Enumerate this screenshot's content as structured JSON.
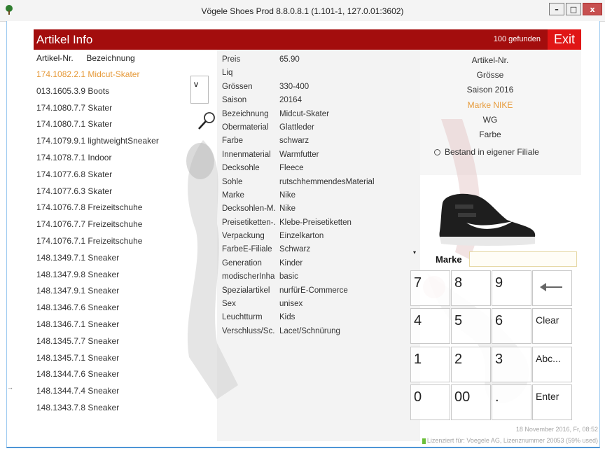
{
  "window": {
    "title": "Vögele Shoes Prod 8.8.0.8.1 (1.101-1, 127.0.01:3602)",
    "min_label": "–",
    "max_label": "□",
    "close_label": "x"
  },
  "header": {
    "title": "Artikel Info",
    "found": "100 gefunden",
    "exit_label": "Exit"
  },
  "list": {
    "col_nr": "Artikel-Nr.",
    "col_bez": "Bezeichnung",
    "rows": [
      {
        "nr": "174.1082.2.1",
        "bez": "Midcut-Skater"
      },
      {
        "nr": "013.1605.3.9",
        "bez": "Boots"
      },
      {
        "nr": "174.1080.7.7",
        "bez": "Skater"
      },
      {
        "nr": "174.1080.7.1",
        "bez": "Skater"
      },
      {
        "nr": "174.1079.9.1",
        "bez": "lightweightSneaker"
      },
      {
        "nr": "174.1078.7.1",
        "bez": "Indoor"
      },
      {
        "nr": "174.1077.6.8",
        "bez": "Skater"
      },
      {
        "nr": "174.1077.6.3",
        "bez": "Skater"
      },
      {
        "nr": "174.1076.7.8",
        "bez": "Freizeitschuhe"
      },
      {
        "nr": "174.1076.7.7",
        "bez": "Freizeitschuhe"
      },
      {
        "nr": "174.1076.7.1",
        "bez": "Freizeitschuhe"
      },
      {
        "nr": "148.1349.7.1",
        "bez": "Sneaker"
      },
      {
        "nr": "148.1347.9.8",
        "bez": "Sneaker"
      },
      {
        "nr": "148.1347.9.1",
        "bez": "Sneaker"
      },
      {
        "nr": "148.1346.7.6",
        "bez": "Sneaker"
      },
      {
        "nr": "148.1346.7.1",
        "bez": "Sneaker"
      },
      {
        "nr": "148.1345.7.7",
        "bez": "Sneaker"
      },
      {
        "nr": "148.1345.7.1",
        "bez": "Sneaker"
      },
      {
        "nr": "148.1344.7.6",
        "bez": "Sneaker"
      },
      {
        "nr": "148.1344.7.4",
        "bez": "Sneaker"
      },
      {
        "nr": "148.1343.7.8",
        "bez": "Sneaker"
      }
    ]
  },
  "v_button": "v",
  "properties": [
    {
      "k": "Preis",
      "v": "65.90"
    },
    {
      "k": "Liq",
      "v": ""
    },
    {
      "k": "Grössen",
      "v": "330-400"
    },
    {
      "k": "Saison",
      "v": "20164"
    },
    {
      "k": "Bezeichnung",
      "v": "Midcut-Skater"
    },
    {
      "k": "Obermaterial",
      "v": "Glattleder"
    },
    {
      "k": "Farbe",
      "v": "schwarz"
    },
    {
      "k": "Innenmaterial",
      "v": "Warmfutter"
    },
    {
      "k": "Decksohle",
      "v": "Fleece"
    },
    {
      "k": "Sohle",
      "v": "rutschhemmendesMaterial"
    },
    {
      "k": "Marke",
      "v": "Nike"
    },
    {
      "k": "Decksohlen-M.",
      "v": "Nike"
    },
    {
      "k": "Preisetiketten-.",
      "v": "Klebe-Preisetiketten"
    },
    {
      "k": "Verpackung",
      "v": "Einzelkarton"
    },
    {
      "k": "FarbeE-Filiale",
      "v": "Schwarz"
    },
    {
      "k": "Generation",
      "v": "Kinder"
    },
    {
      "k": "modischerInha",
      "v": "basic"
    },
    {
      "k": "Spezialartikel",
      "v": "nurfürE-Commerce"
    },
    {
      "k": "Sex",
      "v": "unisex"
    },
    {
      "k": "Leuchtturm",
      "v": "Kids"
    },
    {
      "k": "Verschluss/Sc.",
      "v": "Lacet/Schnürung"
    }
  ],
  "filters": [
    {
      "label": "Artikel-Nr.",
      "highlight": false
    },
    {
      "label": "Grösse",
      "highlight": false
    },
    {
      "label": "Saison 2016",
      "highlight": false
    },
    {
      "label": "Marke NIKE",
      "highlight": true
    },
    {
      "label": "WG",
      "highlight": false
    },
    {
      "label": "Farbe",
      "highlight": false
    }
  ],
  "bestand_label": "Bestand in eigener Filiale",
  "marke": {
    "label": "Marke",
    "value": ""
  },
  "keypad": {
    "k7": "7",
    "k8": "8",
    "k9": "9",
    "k4": "4",
    "k5": "5",
    "k6": "6",
    "k1": "1",
    "k2": "2",
    "k3": "3",
    "k0": "0",
    "k00": "00",
    "kdot": ".",
    "clear": "Clear",
    "abc": "Abc...",
    "enter": "Enter"
  },
  "footer": {
    "date": "18 November 2016, Fr, 08:52",
    "license": "Lizenziert für: Voegele AG, Lizenznummer 20053 (59% used)"
  },
  "colors": {
    "header": "#a30d0d",
    "exit": "#e01515",
    "highlight": "#e69a3a",
    "window_border": "#4d95d6"
  }
}
